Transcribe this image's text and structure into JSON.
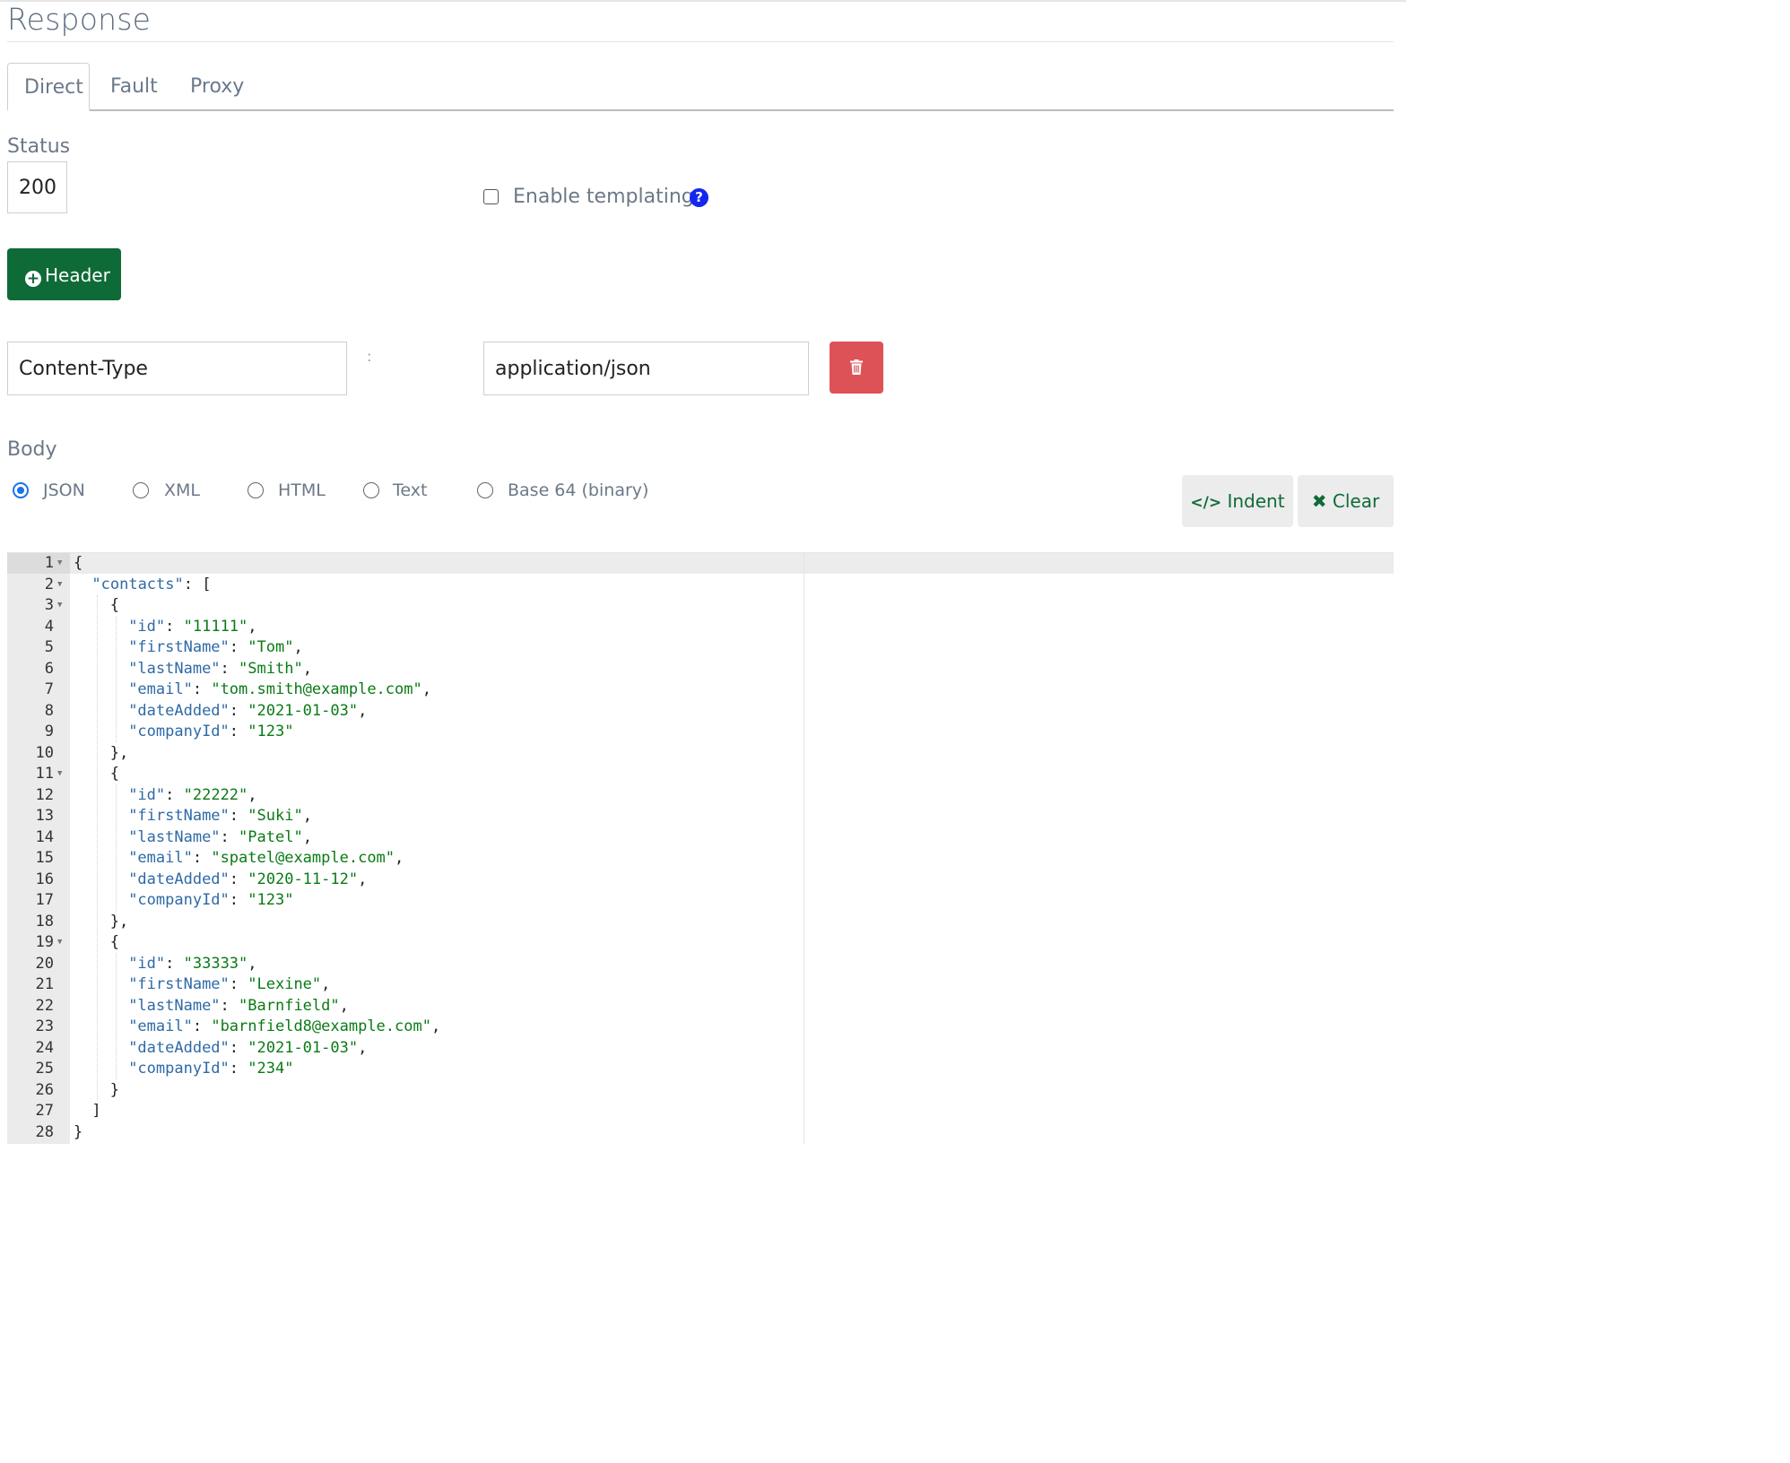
{
  "title": "Response",
  "tabs": [
    {
      "label": "Direct",
      "active": true
    },
    {
      "label": "Fault",
      "active": false
    },
    {
      "label": "Proxy",
      "active": false
    }
  ],
  "status": {
    "label": "Status",
    "value": "200"
  },
  "templating": {
    "label": "Enable templating",
    "checked": false,
    "help": "?"
  },
  "header_button": {
    "label": "Header"
  },
  "header_row": {
    "name": "Content-Type",
    "separator": ":",
    "value": "application/json"
  },
  "body": {
    "label": "Body",
    "formats": [
      {
        "label": "JSON",
        "checked": true
      },
      {
        "label": "XML",
        "checked": false
      },
      {
        "label": "HTML",
        "checked": false
      },
      {
        "label": "Text",
        "checked": false
      },
      {
        "label": "Base 64 (binary)",
        "checked": false
      }
    ],
    "indent_label": "Indent",
    "clear_label": "Clear"
  },
  "editor": {
    "lines": [
      {
        "n": "1",
        "fold": true,
        "indent": 0,
        "text": "{"
      },
      {
        "n": "2",
        "fold": true,
        "indent": 1,
        "key": "\"contacts\"",
        "rest": ": ["
      },
      {
        "n": "3",
        "fold": true,
        "indent": 2,
        "text": "{"
      },
      {
        "n": "4",
        "indent": 3,
        "key": "\"id\"",
        "val": "\"11111\"",
        "tail": ","
      },
      {
        "n": "5",
        "indent": 3,
        "key": "\"firstName\"",
        "val": "\"Tom\"",
        "tail": ","
      },
      {
        "n": "6",
        "indent": 3,
        "key": "\"lastName\"",
        "val": "\"Smith\"",
        "tail": ","
      },
      {
        "n": "7",
        "indent": 3,
        "key": "\"email\"",
        "val": "\"tom.smith@example.com\"",
        "tail": ","
      },
      {
        "n": "8",
        "indent": 3,
        "key": "\"dateAdded\"",
        "val": "\"2021-01-03\"",
        "tail": ","
      },
      {
        "n": "9",
        "indent": 3,
        "key": "\"companyId\"",
        "val": "\"123\"",
        "tail": ""
      },
      {
        "n": "10",
        "indent": 2,
        "text": "},"
      },
      {
        "n": "11",
        "fold": true,
        "indent": 2,
        "text": "{"
      },
      {
        "n": "12",
        "indent": 3,
        "key": "\"id\"",
        "val": "\"22222\"",
        "tail": ","
      },
      {
        "n": "13",
        "indent": 3,
        "key": "\"firstName\"",
        "val": "\"Suki\"",
        "tail": ","
      },
      {
        "n": "14",
        "indent": 3,
        "key": "\"lastName\"",
        "val": "\"Patel\"",
        "tail": ","
      },
      {
        "n": "15",
        "indent": 3,
        "key": "\"email\"",
        "val": "\"spatel@example.com\"",
        "tail": ","
      },
      {
        "n": "16",
        "indent": 3,
        "key": "\"dateAdded\"",
        "val": "\"2020-11-12\"",
        "tail": ","
      },
      {
        "n": "17",
        "indent": 3,
        "key": "\"companyId\"",
        "val": "\"123\"",
        "tail": ""
      },
      {
        "n": "18",
        "indent": 2,
        "text": "},"
      },
      {
        "n": "19",
        "fold": true,
        "indent": 2,
        "text": "{"
      },
      {
        "n": "20",
        "indent": 3,
        "key": "\"id\"",
        "val": "\"33333\"",
        "tail": ","
      },
      {
        "n": "21",
        "indent": 3,
        "key": "\"firstName\"",
        "val": "\"Lexine\"",
        "tail": ","
      },
      {
        "n": "22",
        "indent": 3,
        "key": "\"lastName\"",
        "val": "\"Barnfield\"",
        "tail": ","
      },
      {
        "n": "23",
        "indent": 3,
        "key": "\"email\"",
        "val": "\"barnfield8@example.com\"",
        "tail": ","
      },
      {
        "n": "24",
        "indent": 3,
        "key": "\"dateAdded\"",
        "val": "\"2021-01-03\"",
        "tail": ","
      },
      {
        "n": "25",
        "indent": 3,
        "key": "\"companyId\"",
        "val": "\"234\"",
        "tail": ""
      },
      {
        "n": "26",
        "indent": 2,
        "text": "}"
      },
      {
        "n": "27",
        "indent": 1,
        "text": "]"
      },
      {
        "n": "28",
        "indent": 0,
        "text": "}"
      }
    ]
  },
  "colors": {
    "primary_green": "#0e6b38",
    "danger_red": "#dd5256",
    "help_blue": "#1427f0",
    "radio_blue": "#1a73e8",
    "json_key": "#2e6aa6",
    "json_string": "#0a7a15"
  },
  "icons": {
    "help": "question-circle-icon",
    "add": "plus-circle-icon",
    "delete": "trash-icon",
    "indent": "code-icon",
    "clear": "x-icon",
    "fold": "caret-down-icon"
  }
}
